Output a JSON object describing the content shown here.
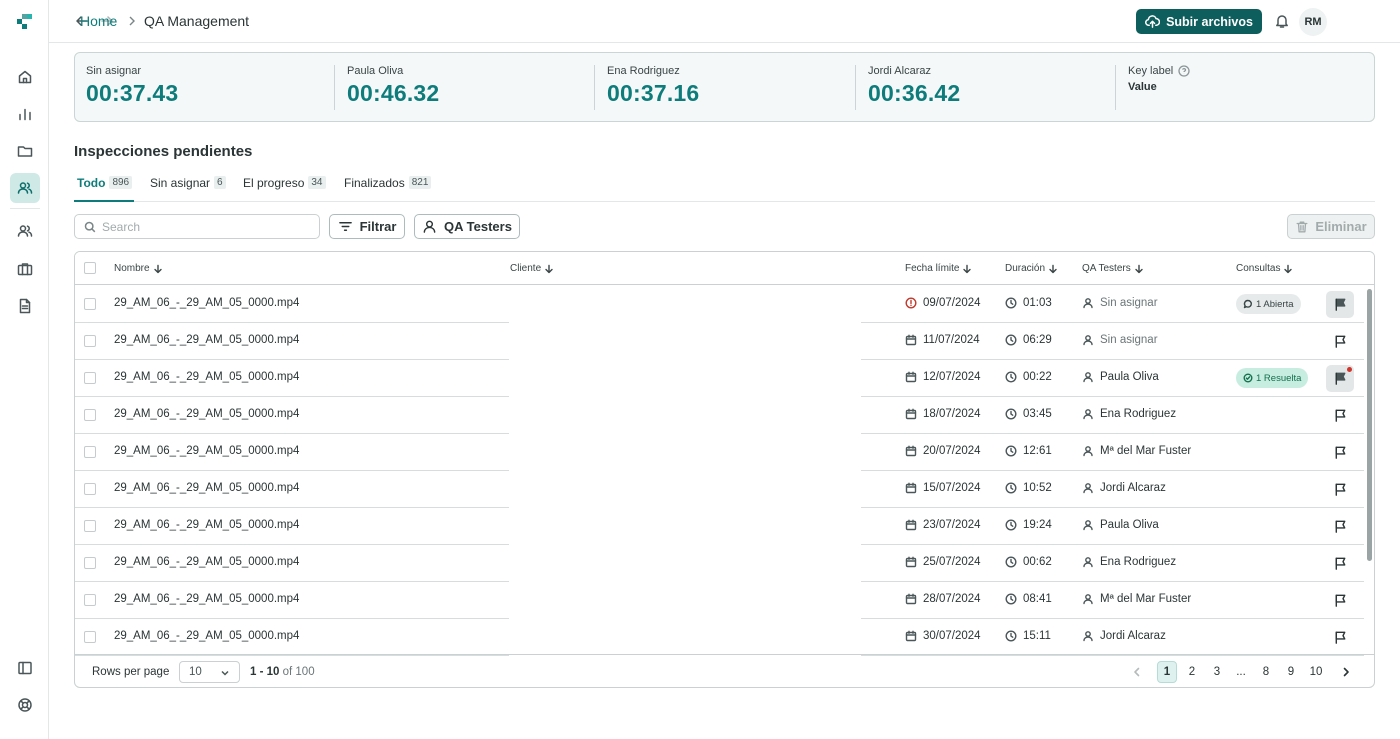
{
  "header": {
    "breadcrumb_home": "Home",
    "breadcrumb_current": "QA Management",
    "upload_label": "Subir archivos",
    "avatar_initials": "RM"
  },
  "stats": [
    {
      "label": "Sin asignar",
      "value": "00:37.43"
    },
    {
      "label": "Paula Oliva",
      "value": "00:46.32"
    },
    {
      "label": "Ena Rodriguez",
      "value": "00:37.16"
    },
    {
      "label": "Jordi Alcaraz",
      "value": "00:36.42"
    }
  ],
  "key_stat": {
    "label": "Key label",
    "value": "Value"
  },
  "section_title": "Inspecciones pendientes",
  "tabs": [
    {
      "label": "Todo",
      "count": "896"
    },
    {
      "label": "Sin asignar",
      "count": "6"
    },
    {
      "label": "El progreso",
      "count": "34"
    },
    {
      "label": "Finalizados",
      "count": "821"
    }
  ],
  "toolbar": {
    "search_placeholder": "Search",
    "filter_label": "Filtrar",
    "testers_label": "QA Testers",
    "delete_label": "Eliminar"
  },
  "table": {
    "headers": {
      "name": "Nombre",
      "client": "Cliente",
      "deadline": "Fecha límite",
      "duration": "Duración",
      "testers": "QA Testers",
      "queries": "Consultas"
    },
    "rows": [
      {
        "name": "29_AM_06_-_29_AM_05_0000.mp4",
        "date": "09/07/2024",
        "duration": "01:03",
        "tester": "Sin asignar",
        "badge": "1 Abierta"
      },
      {
        "name": "29_AM_06_-_29_AM_05_0000.mp4",
        "date": "11/07/2024",
        "duration": "06:29",
        "tester": "Sin asignar",
        "badge": ""
      },
      {
        "name": "29_AM_06_-_29_AM_05_0000.mp4",
        "date": "12/07/2024",
        "duration": "00:22",
        "tester": "Paula Oliva",
        "badge": "1 Resuelta"
      },
      {
        "name": "29_AM_06_-_29_AM_05_0000.mp4",
        "date": "18/07/2024",
        "duration": "03:45",
        "tester": "Ena Rodriguez",
        "badge": ""
      },
      {
        "name": "29_AM_06_-_29_AM_05_0000.mp4",
        "date": "20/07/2024",
        "duration": "12:61",
        "tester": "Mª del Mar Fuster",
        "badge": ""
      },
      {
        "name": "29_AM_06_-_29_AM_05_0000.mp4",
        "date": "15/07/2024",
        "duration": "10:52",
        "tester": "Jordi Alcaraz",
        "badge": ""
      },
      {
        "name": "29_AM_06_-_29_AM_05_0000.mp4",
        "date": "23/07/2024",
        "duration": "19:24",
        "tester": "Paula Oliva",
        "badge": ""
      },
      {
        "name": "29_AM_06_-_29_AM_05_0000.mp4",
        "date": "25/07/2024",
        "duration": "00:62",
        "tester": "Ena Rodriguez",
        "badge": ""
      },
      {
        "name": "29_AM_06_-_29_AM_05_0000.mp4",
        "date": "28/07/2024",
        "duration": "08:41",
        "tester": "Mª del Mar Fuster",
        "badge": ""
      },
      {
        "name": "29_AM_06_-_29_AM_05_0000.mp4",
        "date": "30/07/2024",
        "duration": "15:11",
        "tester": "Jordi Alcaraz",
        "badge": ""
      }
    ]
  },
  "footer": {
    "rows_per_page_label": "Rows per page",
    "rows_per_page_value": "10",
    "range_bold": "1 - 10",
    "range_rest": "of 100",
    "pages": [
      "1",
      "2",
      "3",
      "...",
      "8",
      "9",
      "10"
    ]
  },
  "colors": {
    "accent": "#0e7c7b",
    "primary_button": "#0d5e5c",
    "error": "#c0392b"
  }
}
